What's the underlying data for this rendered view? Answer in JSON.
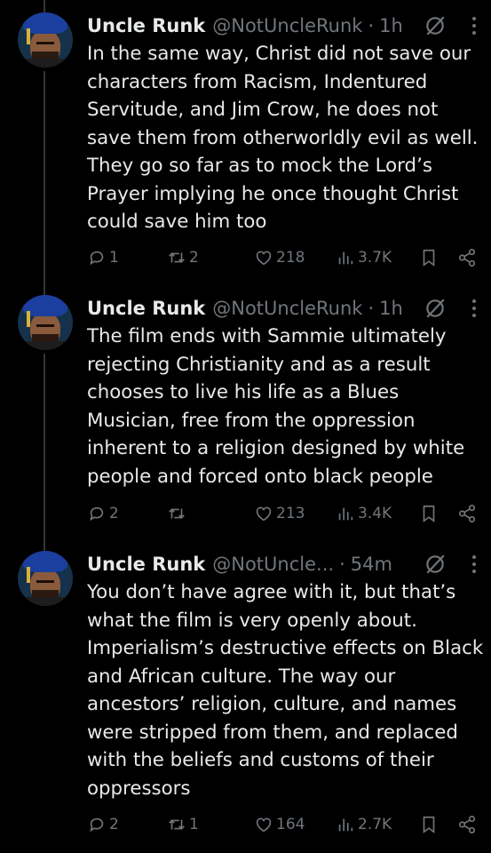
{
  "tweets": [
    {
      "name": "Uncle Runk",
      "handle": "@NotUncleRunk",
      "separator": "·",
      "time": "1h",
      "text": "In the same way, Christ did not save our characters from Racism, Indentured Servitude, and Jim Crow, he does not save them from otherworldly evil as well. They go so far as to mock the Lord’s Prayer implying he once thought Christ could save him too",
      "replies": "1",
      "reposts": "2",
      "likes": "218",
      "views": "3.7K"
    },
    {
      "name": "Uncle Runk",
      "handle": "@NotUncleRunk",
      "separator": "·",
      "time": "1h",
      "text": "The film ends with Sammie ultimately rejecting Christianity and as a result chooses to live his life as a Blues Musician, free from the oppression inherent to a religion designed by white people and forced onto black people",
      "replies": "2",
      "reposts": "",
      "likes": "213",
      "views": "3.4K"
    },
    {
      "name": "Uncle Runk",
      "handle": "@NotUncle...",
      "separator": "·",
      "time": "54m",
      "text": "You don’t have agree with it, but that’s what the film is very openly about. Imperialism’s destructive effects on Black and African culture. The way our ancestors’ religion, culture, and names were stripped from them, and replaced with the beliefs and customs of their oppressors",
      "replies": "2",
      "reposts": "1",
      "likes": "164",
      "views": "2.7K"
    }
  ],
  "icons": [
    "grok-icon",
    "more-icon",
    "reply-icon",
    "repost-icon",
    "like-icon",
    "views-icon",
    "bookmark-icon",
    "share-icon"
  ],
  "colors": {
    "background": "#000000",
    "text": "#e7e9ea",
    "muted": "#71767b",
    "thread_line": "#333639"
  }
}
